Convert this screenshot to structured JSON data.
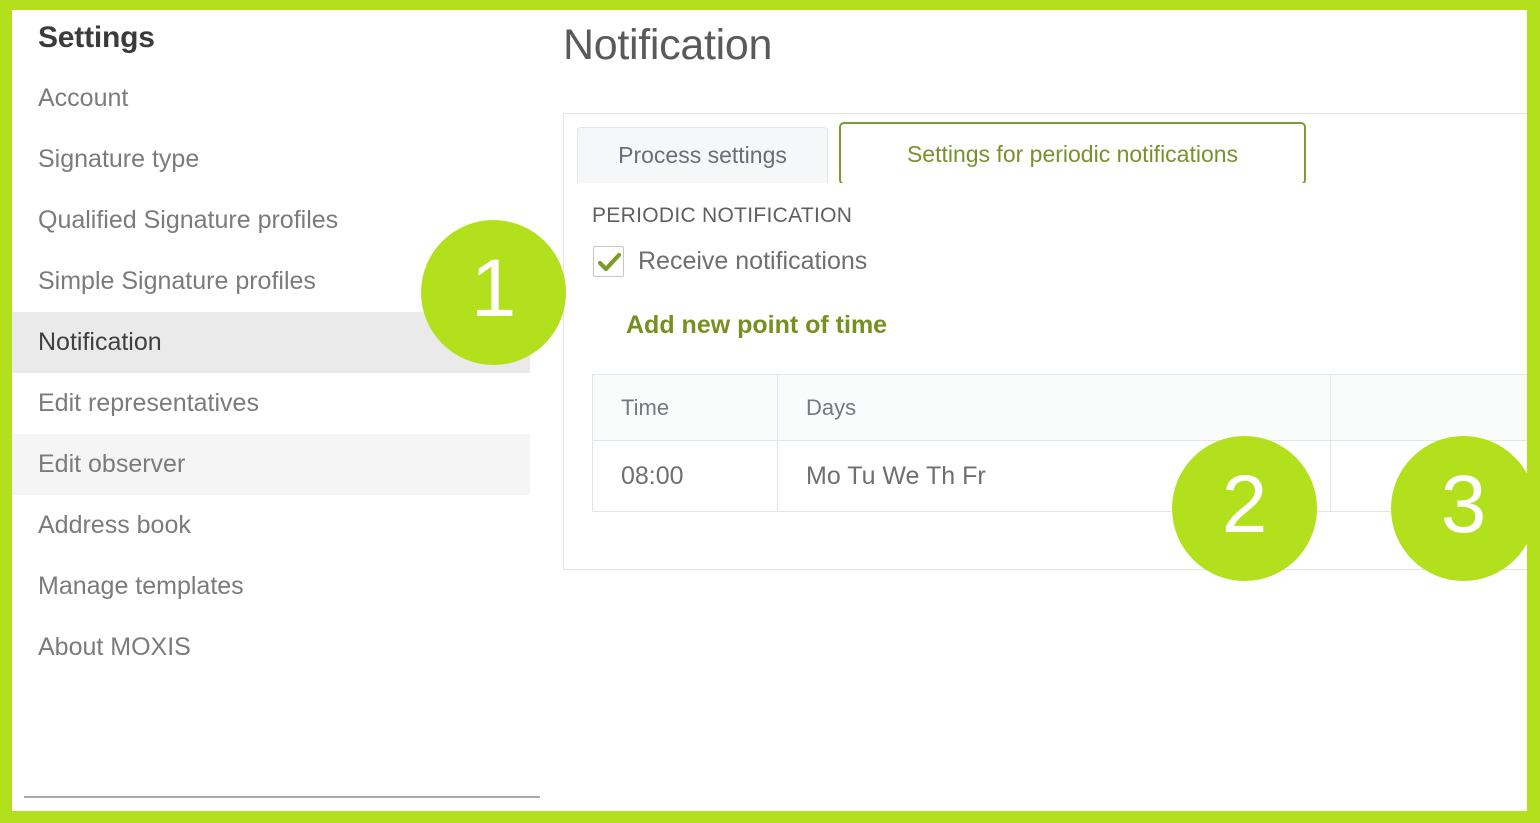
{
  "theme": {
    "frame_green": "#b3e01c",
    "accent_olive": "#77922d",
    "badge_green": "#b3e01c",
    "active_nav_bg": "#eaeaea"
  },
  "sidebar": {
    "title": "Settings",
    "items": [
      {
        "label": "Account",
        "state": "normal"
      },
      {
        "label": "Signature type",
        "state": "normal"
      },
      {
        "label": "Qualified Signature profiles",
        "state": "normal"
      },
      {
        "label": "Simple Signature profiles",
        "state": "normal"
      },
      {
        "label": "Notification",
        "state": "active"
      },
      {
        "label": "Edit representatives",
        "state": "normal"
      },
      {
        "label": "Edit observer",
        "state": "hover"
      },
      {
        "label": "Address book",
        "state": "normal"
      },
      {
        "label": "Manage templates",
        "state": "normal"
      },
      {
        "label": "About MOXIS",
        "state": "normal"
      }
    ]
  },
  "main": {
    "page_title": "Notification",
    "tabs": [
      {
        "label": "Process settings",
        "active": false
      },
      {
        "label": "Settings for periodic notifications",
        "active": true
      }
    ],
    "section_label": "PERIODIC NOTIFICATION",
    "checkbox": {
      "label": "Receive notifications",
      "checked": true
    },
    "add_link": "Add new point of time",
    "table": {
      "columns": [
        "Time",
        "Days",
        ""
      ],
      "rows": [
        {
          "time": "08:00",
          "days": "Mo Tu We Th Fr",
          "actions": [
            "edit-pencil-icon",
            "delete-x-icon"
          ]
        }
      ]
    }
  },
  "callouts": [
    {
      "number": "1"
    },
    {
      "number": "2"
    },
    {
      "number": "3"
    }
  ]
}
